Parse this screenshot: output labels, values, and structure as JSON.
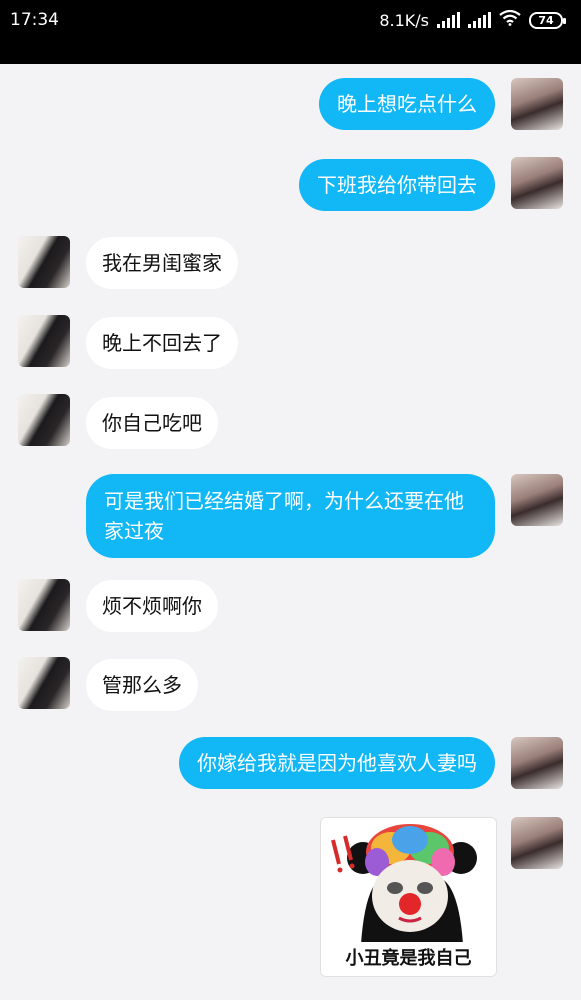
{
  "status_bar": {
    "time": "17:34",
    "network_speed": "8.1K/s",
    "battery_level": "74"
  },
  "messages": [
    {
      "side": "out",
      "text": "晚上想吃点什么"
    },
    {
      "side": "out",
      "text": "下班我给你带回去"
    },
    {
      "side": "in",
      "text": "我在男闺蜜家"
    },
    {
      "side": "in",
      "text": "晚上不回去了"
    },
    {
      "side": "in",
      "text": "你自己吃吧"
    },
    {
      "side": "out",
      "text": "可是我们已经结婚了啊，为什么还要在他家过夜"
    },
    {
      "side": "in",
      "text": "烦不烦啊你"
    },
    {
      "side": "in",
      "text": "管那么多"
    },
    {
      "side": "out",
      "text": "你嫁给我就是因为他喜欢人妻吗"
    }
  ],
  "sticker": {
    "caption": "小丑竟是我自己"
  }
}
